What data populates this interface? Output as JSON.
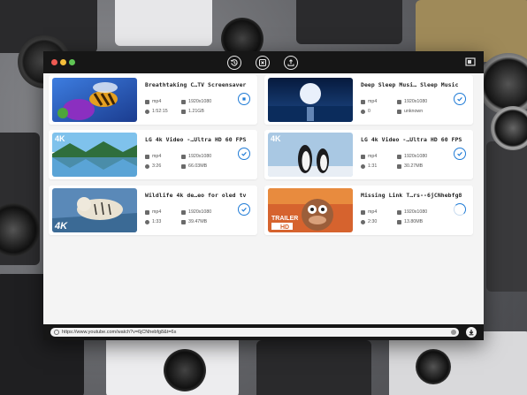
{
  "toolbar": {
    "buttons": [
      "history-icon",
      "convert-icon",
      "share-icon"
    ],
    "corner_icon": "window-mode-icon"
  },
  "videos": [
    {
      "title": "Breathtaking C…TV Screensaver",
      "format": "mp4",
      "resolution": "1920x1080",
      "duration": "1:52:15",
      "size": "1.21GB",
      "status": "downloading"
    },
    {
      "title": "Deep Sleep Musi… Sleep Music",
      "format": "mp4",
      "resolution": "1920x1080",
      "duration": "0",
      "size": "unknown",
      "status": "done"
    },
    {
      "title": "LG 4k Video -…Ultra HD 60 FPS",
      "format": "mp4",
      "resolution": "1920x1080",
      "duration": "3:26",
      "size": "66.03MB",
      "status": "done"
    },
    {
      "title": "LG 4k Video -…Ultra HD 60 FPS",
      "format": "mp4",
      "resolution": "1920x1080",
      "duration": "1:31",
      "size": "30.27MB",
      "status": "done"
    },
    {
      "title": "Wildlife 4k de…eo for oled tv",
      "format": "mp4",
      "resolution": "1920x1080",
      "duration": "1:33",
      "size": "39.47MB",
      "status": "done"
    },
    {
      "title": "Missing Link T…rs--6jCNhebfg8",
      "format": "mp4",
      "resolution": "1920x1080",
      "duration": "2:30",
      "size": "13.80MB",
      "status": "loading"
    }
  ],
  "thumb_labels": [
    "4K",
    "4K",
    "4K",
    "TRAILER",
    "HD"
  ],
  "url": {
    "value": "https://www.youtube.com/watch?v=6jCNhebfg8&t=6s"
  },
  "colors": {
    "accent": "#1f7bd6",
    "titlebar": "#161616"
  }
}
